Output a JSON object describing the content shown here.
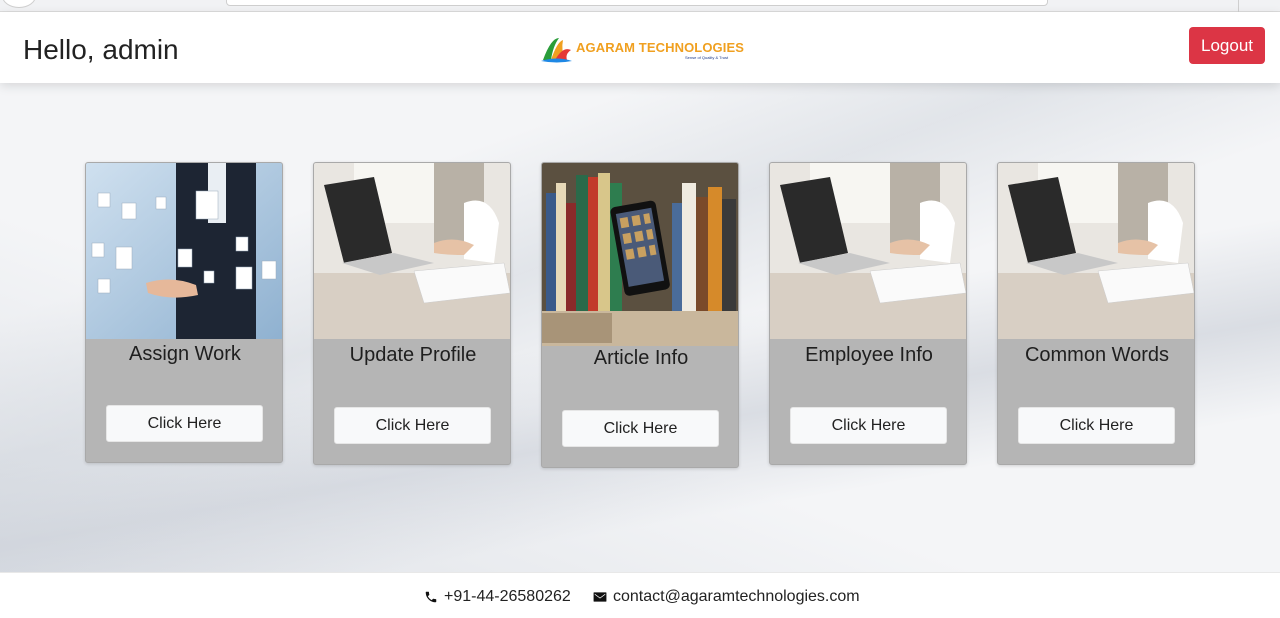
{
  "header": {
    "greeting": "Hello, admin",
    "logo_text": "AGARAM TECHNOLOGIES",
    "logo_tagline": "Sense of Quality & Trust",
    "logout_label": "Logout",
    "logout_color": "#dc3545"
  },
  "cards": [
    {
      "title": "Assign Work",
      "button": "Click Here",
      "image": "business-network-image"
    },
    {
      "title": "Update Profile",
      "button": "Click Here",
      "image": "laptop-desk-image"
    },
    {
      "title": "Article Info",
      "button": "Click Here",
      "image": "bookshelf-tablet-image"
    },
    {
      "title": "Employee Info",
      "button": "Click Here",
      "image": "laptop-desk-image"
    },
    {
      "title": "Common Words",
      "button": "Click Here",
      "image": "laptop-desk-image"
    }
  ],
  "footer": {
    "phone": "+91-44-26580262",
    "email": "contact@agaramtechnologies.com",
    "phone_icon": "phone-icon",
    "email_icon": "envelope-icon"
  }
}
